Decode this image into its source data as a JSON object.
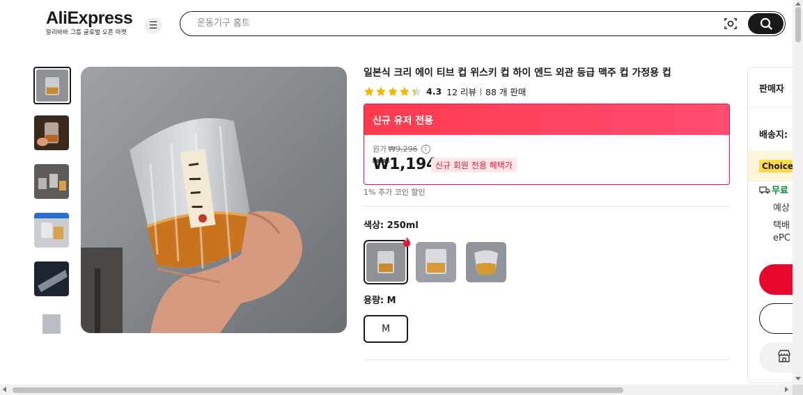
{
  "header": {
    "logo_text": "AliExpress",
    "logo_subtitle": "알리바바 그룹 글로벌 오픈 마켓",
    "menu_icon": "hamburger-menu-icon",
    "search_placeholder": "운동기구 홈트",
    "camera_icon": "camera-search-icon",
    "search_icon": "search-icon"
  },
  "gallery": {
    "thumbnail_count": 6,
    "selected_index": 0
  },
  "product": {
    "title": "일본식 크리 에이 티브 컵 위스키 컵 하이 엔드 외관 등급 맥주 컵 가정용 컵",
    "rating": 4.3,
    "rating_text": "4.3",
    "reviews": "12 리뷰",
    "sold": "88 개 판매",
    "promo_header": "신규 유저 전용",
    "original_price_label": "원가",
    "original_price": "₩9,296",
    "price": "₩1,194",
    "price_badge": "신규 회원 전용 혜택가",
    "coin_discount": "1% 추가 코인 할인",
    "color_label": "색상: 250ml",
    "capacity_label": "용량: M",
    "size_option": "M"
  },
  "right_panel": {
    "seller_label": "판매자",
    "ship_to_label": "배송지:",
    "choice_badge": "Choice",
    "free_shipping": "무료",
    "line1": "예상",
    "line2": "택배",
    "line3": "ePC"
  },
  "colors": {
    "accent_red": "#e6072c",
    "promo_gradient_start": "#ff3b4e",
    "promo_gradient_end": "#ff4c72",
    "star": "#f7b500",
    "choice_yellow": "#ffd94a",
    "free_green": "#0a8a3a"
  }
}
